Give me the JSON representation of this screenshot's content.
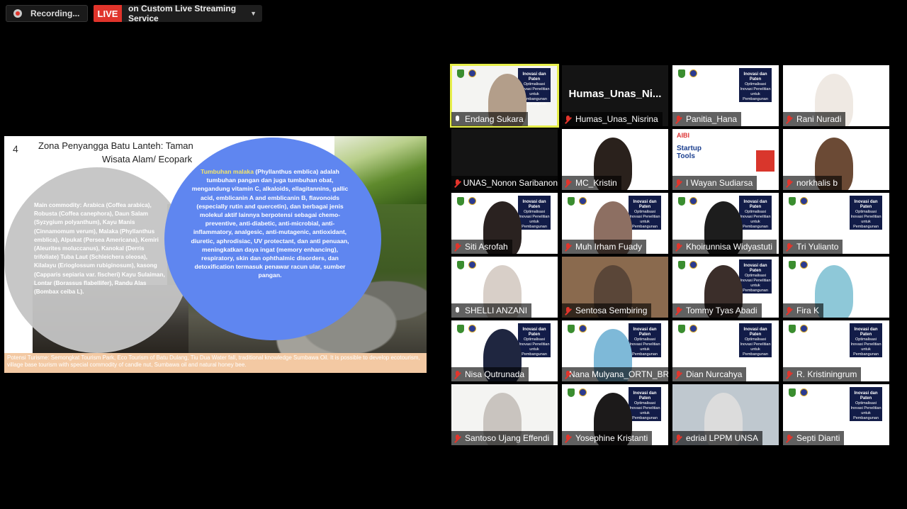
{
  "topbar": {
    "recording_label": "Recording...",
    "live_label": "LIVE",
    "stream_label": "on Custom Live Streaming Service"
  },
  "slide": {
    "number": "4",
    "title_line1": "Zona Penyangga Batu Lanteh: Taman",
    "title_line2": "Wisata Alam/ Ecopark",
    "grey_text": "Main commodity: Arabica (Coffea arabica), Robusta (Coffea canephora), Daun Salam (Syzygium polyanthum), Kayu Manis (Cinnamomum verum), Malaka (Phyllanthus emblica), Alpukat (Persea Americana), Kemiri (Aleurites moluccanus), Kanokal (Derris trifoliate) Tuba Laut (Schleichera oleosa), Kilalayu (Erioglossum rubiginosum), kasong (Capparis sepiaria var. fischeri) Kayu Sulaiman, Lontar (Borassus flabellifer), Randu Alas (Bombax ceiba L).",
    "blue_highlight": "Tumbuhan malaka",
    "blue_text": " (Phyllanthus emblica) adalah tumbuhan pangan dan juga tumbuhan obat, mengandung vitamin C, alkaloids, ellagitannins, gallic acid, emblicanin A and emblicanin B, flavonoids (especially rutin and quercetin), dan berbagai jenis molekul aktif lainnya berpotensi sebagai chemo-preventive, anti-diabetic, anti-microbial, anti-inflammatory, analgesic, anti-mutagenic, antioxidant, diuretic, aphrodisiac, UV protectant, dan anti penuaan, meningkatkan daya ingat (memory enhancing), respiratory, skin dan ophthalmic disorders, dan detoxification termasuk penawar racun ular, sumber pangan.",
    "footer": "Potensi Turisme: Semongkat Tourism Park, Eco Tourism of Batu Dulang, Tiu Dua Water fall, traditional knowledge Sumbawa Oil. It is possible to develop ecotourism, village base tourism with special commodity of candle nut, Sumbawa oil and natural honey bee."
  },
  "participants": [
    {
      "name": "Endang Sukara",
      "muted": false
    },
    {
      "name": "Humas_Unas_Nisrina",
      "muted": true,
      "big_label": "Humas_Unas_Ni..."
    },
    {
      "name": "Panitia_Hana",
      "muted": true
    },
    {
      "name": "Rani Nuradi",
      "muted": true
    },
    {
      "name": "UNAS_Nonon Saribanon",
      "muted": true
    },
    {
      "name": "MC_Kristin",
      "muted": true
    },
    {
      "name": "I Wayan Sudiarsa",
      "muted": true
    },
    {
      "name": "norkhalis b",
      "muted": true
    },
    {
      "name": "Siti Asrofah",
      "muted": true
    },
    {
      "name": "Muh Irham Fuady",
      "muted": true
    },
    {
      "name": "Khoirunnisa Widyastuti",
      "muted": true
    },
    {
      "name": "Tri Yulianto",
      "muted": true
    },
    {
      "name": "SHELLI ANZANI",
      "muted": false
    },
    {
      "name": "Sentosa Sembiring",
      "muted": true
    },
    {
      "name": "Tommy Tyas Abadi",
      "muted": true
    },
    {
      "name": "Fira K",
      "muted": true
    },
    {
      "name": "Nisa Qutrunada",
      "muted": true
    },
    {
      "name": "Nana Mulyana_ORTN_BRIN",
      "muted": true
    },
    {
      "name": "Dian Nurcahya",
      "muted": true
    },
    {
      "name": "R. Kristiningrum",
      "muted": true
    },
    {
      "name": "Santoso Ujang Effendi",
      "muted": true
    },
    {
      "name": "Yosephine Kristanti",
      "muted": true
    },
    {
      "name": "edrial LPPM UNSA",
      "muted": true
    },
    {
      "name": "Septi Dianti",
      "muted": true
    }
  ],
  "banner": {
    "title": "Inovasi dan Paten",
    "sub": "Optimalisasi Inovasi Penelitian untuk Pembangunan Berkelanjutan"
  },
  "wayan_tile": {
    "brand": "AIBI",
    "line1": "Startup",
    "line2": "Tools"
  },
  "colors": {
    "live_red": "#e0342b",
    "active_speaker": "#e6ee4a",
    "slide_blue_circle": "#5f86f0",
    "mute_red": "#e3342b"
  }
}
